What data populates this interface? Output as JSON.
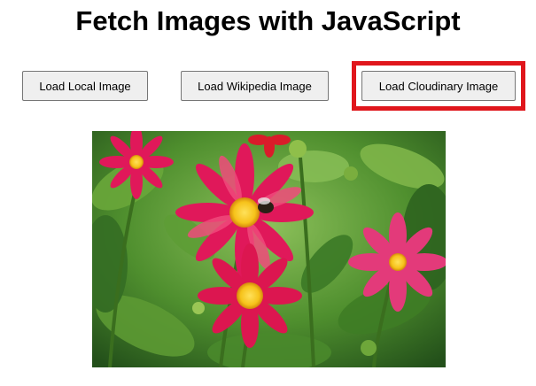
{
  "page": {
    "title": "Fetch Images with JavaScript"
  },
  "buttons": {
    "local_label": "Load Local Image",
    "wikipedia_label": "Load Wikipedia Image",
    "cloudinary_label": "Load Cloudinary Image"
  },
  "highlight": {
    "color": "#e0161c",
    "target": "cloudinary_button"
  },
  "image": {
    "subject": "pink dahlia flowers with a bee",
    "colors": {
      "petal": "#e0185a",
      "center": "#f6c21a",
      "foliage": "#4f8f2e"
    }
  }
}
